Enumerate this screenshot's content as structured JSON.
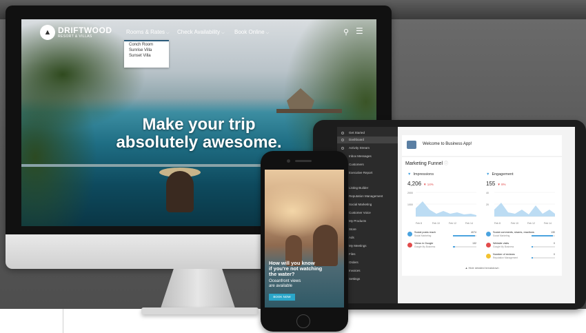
{
  "imac": {
    "logo": {
      "name": "DRIFTWOOD",
      "tagline": "RESORT & VILLAS"
    },
    "nav": [
      {
        "label": "Rooms & Rates"
      },
      {
        "label": "Check Availability"
      },
      {
        "label": "Book Online"
      }
    ],
    "dropdown": [
      "Conch Room",
      "Sunrise Villa",
      "Sunset Villa"
    ],
    "hero": {
      "line1": "Make your trip",
      "line2": "absolutely awesome."
    }
  },
  "tablet": {
    "sidebar": [
      "Get Started",
      "Dashboard",
      "Activity Stream",
      "Inbox Messages",
      "Customers",
      "Executive Report",
      "Listing Builder",
      "Reputation Management",
      "Social Marketing",
      "Customer Voice",
      "My Products",
      "Store",
      "Ads",
      "My Meetings",
      "Files",
      "Orders",
      "Invoices",
      "Settings"
    ],
    "welcome": "Welcome to Business App!",
    "funnel_title": "Marketing Funnel",
    "impressions": {
      "label": "Impressions",
      "value": "4,206",
      "delta": "▼ 14%",
      "ymax": "2000",
      "ymid": "1000",
      "xlabels": [
        "Feb 8",
        "Feb 10",
        "Feb 12",
        "Feb 14"
      ]
    },
    "engagement": {
      "label": "Engagement",
      "value": "155",
      "delta": "▼ 8%",
      "ymax": "40",
      "ymid": "20",
      "xlabels": [
        "Feb 8",
        "Feb 10",
        "Feb 12",
        "Feb 14"
      ]
    },
    "left_stats": [
      {
        "title": "Social posts reach",
        "sub": "Social Marketing",
        "value": "4074",
        "fill": 0.95,
        "color": "#4aa3df"
      },
      {
        "title": "Views in Google",
        "sub": "Google My Business",
        "value": "132",
        "fill": 0.1,
        "color": "#e24c4c"
      }
    ],
    "right_stats": [
      {
        "title": "Social comments, shares, reactions",
        "sub": "Social Marketing",
        "value": "130",
        "fill": 0.9,
        "color": "#4aa3df"
      },
      {
        "title": "Website visits",
        "sub": "Google My Business",
        "value": "0",
        "fill": 0.05,
        "color": "#e24c4c"
      },
      {
        "title": "Number of reviews",
        "sub": "Reputation Management",
        "value": "0",
        "fill": 0.05,
        "color": "#f2c230"
      }
    ],
    "hide_link": "Hide detailed breakdown"
  },
  "phone": {
    "headline_1": "How will you know",
    "headline_2": "if you're not watching",
    "headline_3": "the water?",
    "sub_1": "Oceanfront views",
    "sub_2": "are available",
    "button": "BOOK NOW"
  }
}
